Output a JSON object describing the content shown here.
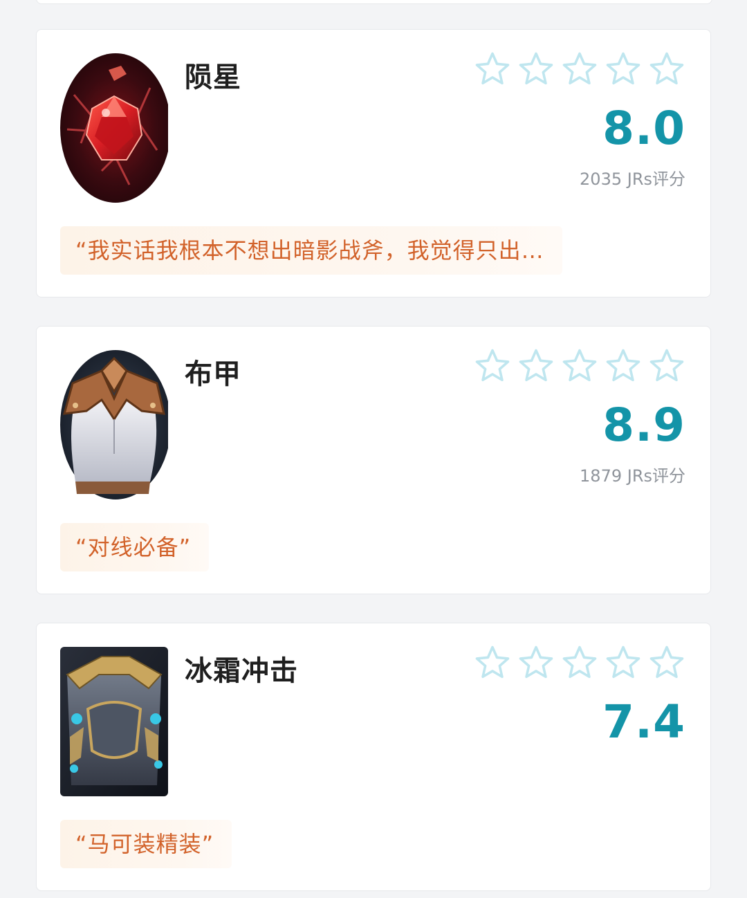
{
  "colors": {
    "accent": "#1494a8",
    "star_outline": "#bfe6ef",
    "quote_text": "#d2622a",
    "quote_bg": "#fdf3e8"
  },
  "items": [
    {
      "name": "陨星",
      "icon": "meteor-gem-icon",
      "stars_max": 5,
      "stars_filled": 0,
      "score": "8.0",
      "raters": "2035 JRs评分",
      "quote": "“我实话我根本不想出暗影战斧，我觉得只出…"
    },
    {
      "name": "布甲",
      "icon": "cloth-armor-icon",
      "stars_max": 5,
      "stars_filled": 0,
      "score": "8.9",
      "raters": "1879 JRs评分",
      "quote": "“对线必备”"
    },
    {
      "name": "冰霜冲击",
      "icon": "frost-impact-armor-icon",
      "stars_max": 5,
      "stars_filled": 0,
      "score": "7.4",
      "raters": "",
      "quote": "“马可装精装”"
    }
  ]
}
